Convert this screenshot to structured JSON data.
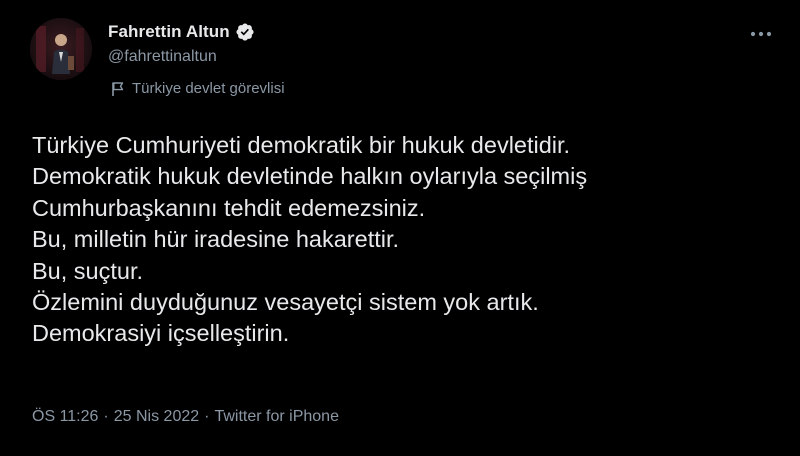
{
  "tweet": {
    "author": {
      "display_name": "Fahrettin Altun",
      "handle": "@fahrettinaltun",
      "verified": true,
      "affiliation_label": "Türkiye devlet görevlisi"
    },
    "body_lines": [
      "Türkiye Cumhuriyeti demokratik bir hukuk devletidir.",
      "Demokratik hukuk devletinde halkın oylarıyla seçilmiş",
      "Cumhurbaşkanını tehdit edemezsiniz.",
      "Bu, milletin hür iradesine hakarettir.",
      "Bu, suçtur.",
      "Özlemini duyduğunuz vesayetçi sistem yok artık.",
      "Demokrasiyi içselleştirin."
    ],
    "meta": {
      "time": "ÖS 11:26",
      "separator": "·",
      "date": "25 Nis 2022",
      "source": "Twitter for iPhone"
    }
  },
  "colors": {
    "background": "#000000",
    "primary_text": "#e7e9ea",
    "secondary_text": "#8b98a5",
    "verified_badge": "#e7e9ea"
  },
  "icons": {
    "verified": "verified-badge-icon",
    "affiliation": "flag-icon",
    "more": "more-options-icon"
  }
}
